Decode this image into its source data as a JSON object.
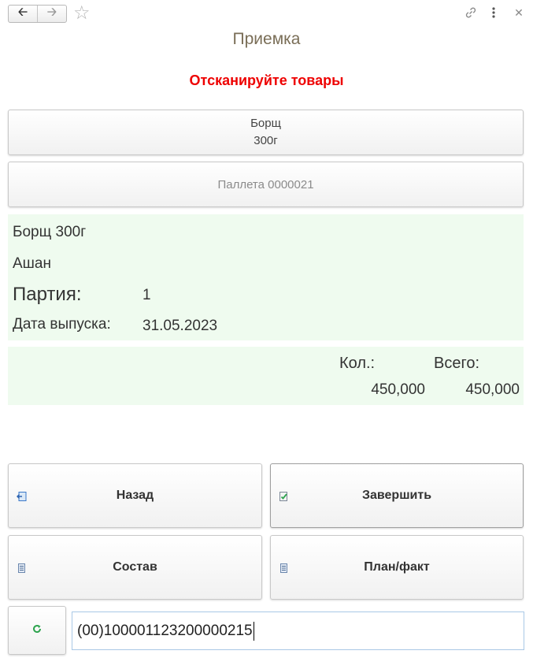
{
  "toolbar": {
    "back_icon": "arrow-left-icon",
    "forward_icon": "arrow-right-icon",
    "favorite_icon": "star-icon",
    "link_icon": "link-icon",
    "more_icon": "more-vertical-icon",
    "close_icon": "close-icon"
  },
  "window": {
    "title": "Приемка"
  },
  "status_message": "Отсканируйте товары",
  "colors": {
    "status": "#ee0000",
    "panel_bg": "#effbef",
    "title": "#7a6e57"
  },
  "product_button": {
    "line1": "Борщ",
    "line2": "300г"
  },
  "pallet_button": {
    "label": "Паллета 0000021"
  },
  "info": {
    "product_name": "Борщ 300г",
    "supplier": "Ашан",
    "batch_label": "Партия:",
    "batch_value": "1",
    "release_date_label": "Дата выпуска:",
    "release_date_value": "31.05.2023"
  },
  "quantity": {
    "qty_label": "Кол.:",
    "total_label": "Всего:",
    "qty_value": "450,000",
    "total_value": "450,000"
  },
  "actions": {
    "back": {
      "label": "Назад",
      "icon": "exit-icon"
    },
    "finish": {
      "label": "Завершить",
      "icon": "check-document-icon"
    },
    "contents": {
      "label": "Состав",
      "icon": "list-document-icon"
    },
    "plan_fact": {
      "label": "План/факт",
      "icon": "list-document-icon"
    },
    "refresh": {
      "icon": "refresh-icon"
    }
  },
  "barcode_input": {
    "value": "(00)100001123200000215"
  }
}
